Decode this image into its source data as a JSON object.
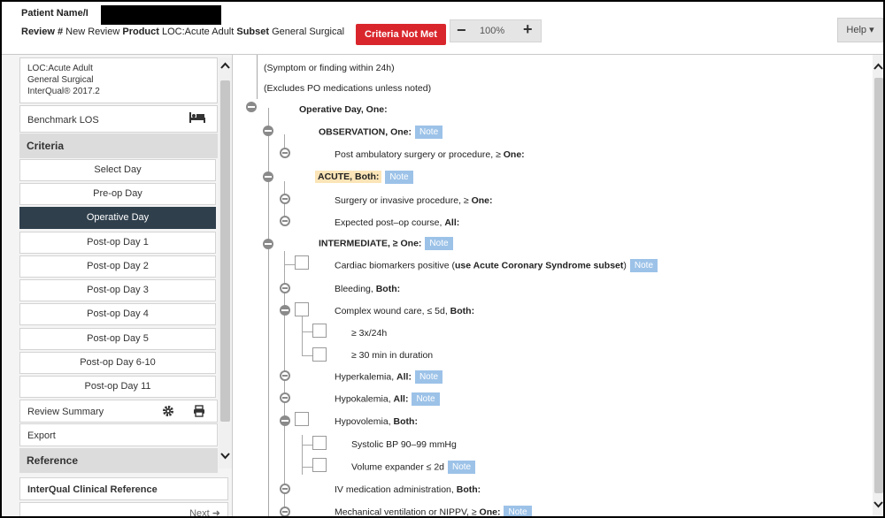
{
  "header": {
    "patient_label": "Patient Name/I",
    "review_label": "Review #",
    "review_value": "New Review",
    "product_label": "Product",
    "product_value": "LOC:Acute Adult",
    "subset_label": "Subset",
    "subset_value": "General Surgical",
    "criteria_status": "Criteria Not Met",
    "zoom_minus": "−",
    "zoom_value": "100%",
    "zoom_plus": "+",
    "help_label": "Help ▾"
  },
  "sidebar": {
    "loc_lines": [
      "LOC:Acute Adult",
      "General Surgical",
      "InterQual® 2017.2"
    ],
    "benchmark_label": "Benchmark LOS",
    "criteria_label": "Criteria",
    "days": [
      {
        "label": "Select Day"
      },
      {
        "label": "Pre-op Day"
      },
      {
        "label": "Operative Day",
        "selected": true
      },
      {
        "label": "Post-op Day 1"
      },
      {
        "label": "Post-op Day 2"
      },
      {
        "label": "Post-op Day 3"
      },
      {
        "label": "Post-op Day 4"
      },
      {
        "label": "Post-op Day 5"
      },
      {
        "label": "Post-op Day 6-10"
      },
      {
        "label": "Post-op Day 11"
      }
    ],
    "review_summary_label": "Review Summary",
    "export_label": "Export",
    "reference_label": "Reference",
    "clinical_reference_label": "InterQual Clinical Reference",
    "next_label": "Next"
  },
  "criteria": {
    "note_label": "Note",
    "lines": [
      {
        "text": "(Symptom or finding within 24h)"
      },
      {
        "text": "(Excludes PO medications unless noted)"
      },
      {
        "text": "Operative Day, One:"
      },
      {
        "text": "OBSERVATION, One:",
        "note": true
      },
      {
        "pre": "Post ambulatory surgery or procedure, ≥ ",
        "bold": "One:"
      },
      {
        "text": "ACUTE, Both:",
        "note": true
      },
      {
        "pre": "Surgery or invasive procedure, ≥ ",
        "bold": "One:"
      },
      {
        "pre": "Expected post–op course, ",
        "bold": "All:"
      },
      {
        "text": "INTERMEDIATE, ≥ One:",
        "note": true
      },
      {
        "pre": "Cardiac biomarkers positive (",
        "bold": "use Acute Coronary Syndrome subset",
        "post": ")",
        "note": true
      },
      {
        "pre": "Bleeding, ",
        "bold": "Both:"
      },
      {
        "pre": "Complex wound care, ≤ 5d, ",
        "bold": "Both:"
      },
      {
        "text": "≥ 3x/24h"
      },
      {
        "text": "≥ 30 min in duration"
      },
      {
        "pre": "Hyperkalemia, ",
        "bold": "All:",
        "note": true
      },
      {
        "pre": "Hypokalemia, ",
        "bold": "All:",
        "note": true
      },
      {
        "pre": "Hypovolemia, ",
        "bold": "Both:"
      },
      {
        "text": "Systolic BP 90–99 mmHg"
      },
      {
        "text": "Volume expander ≤ 2d",
        "note": true
      },
      {
        "pre": "IV medication administration, ",
        "bold": "Both:"
      },
      {
        "pre": "Mechanical ventilation or NIPPV, ≥ ",
        "bold": "One:",
        "note": true
      }
    ]
  },
  "icons": {
    "bed": "bed-icon",
    "gear": "gear-icon",
    "printer": "printer-icon",
    "next": "arrow-right-circle-icon"
  },
  "colors": {
    "criteria_not_met": "#d9262c",
    "selected_day": "#2f3f4c",
    "note_badge": "#9cc2e8",
    "acute_highlight": "#fbe5b8"
  }
}
